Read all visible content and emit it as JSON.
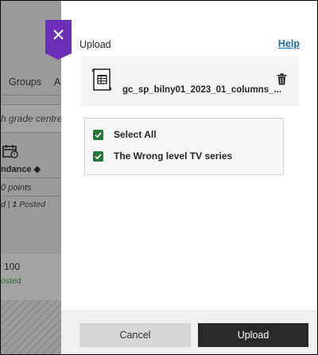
{
  "background": {
    "tabs": [
      "Groups",
      "A"
    ],
    "search_placeholder": "h grade centre",
    "column_header": "ndance",
    "points": "0 points",
    "posted_prefix": "d | ",
    "posted_count": "1",
    "posted_suffix": " Posted",
    "grade_value": "100",
    "grade_status": "osted"
  },
  "panel": {
    "title": "Upload",
    "help_label": "Help",
    "file_name": "gc_sp_bilny01_2023_01_columns_...",
    "options": [
      {
        "label": "Select All",
        "checked": true
      },
      {
        "label": "The Wrong level TV series",
        "checked": true
      }
    ],
    "cancel_label": "Cancel",
    "upload_label": "Upload"
  },
  "colors": {
    "close_tab": "#6c2fb9",
    "checkbox": "#1f7a3a",
    "help_link": "#1d6fb3",
    "primary_button": "#2a2a2a"
  },
  "icons": [
    "close-icon",
    "spreadsheet-file-icon",
    "trash-icon",
    "checkmark-icon",
    "calendar-icon",
    "sort-icon"
  ]
}
